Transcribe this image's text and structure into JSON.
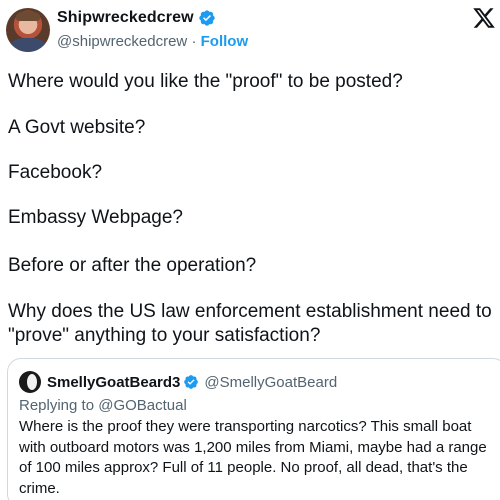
{
  "post": {
    "author": {
      "display_name": "Shipwreckedcrew",
      "handle": "@shipwreckedcrew",
      "separator": "·",
      "follow_label": "Follow"
    },
    "paragraphs": [
      "Where would you like the \"proof\" to be posted?",
      "A Govt website?",
      "Facebook?",
      "Embassy Webpage?",
      "Before or after the operation?",
      "Why does the US law enforcement establishment need to \"prove\" anything to your satisfaction?"
    ]
  },
  "quoted_post": {
    "author": {
      "display_name": "SmellyGoatBeard3",
      "handle": "@SmellyGoatBeard"
    },
    "replying_to": "Replying to @GOBactual",
    "text": "Where is the proof they were transporting narcotics? This small boat with outboard motors was 1,200 miles from Miami, maybe had a range of 100 miles approx? Full of 11 people. No proof, all dead, that's the crime."
  },
  "icons": {
    "verified": "verified-badge-icon",
    "logo": "x-logo-icon"
  },
  "colors": {
    "accent": "#1d9bf0",
    "text": "#0f1419",
    "secondary_text": "#536471",
    "border": "#cfd9de"
  }
}
